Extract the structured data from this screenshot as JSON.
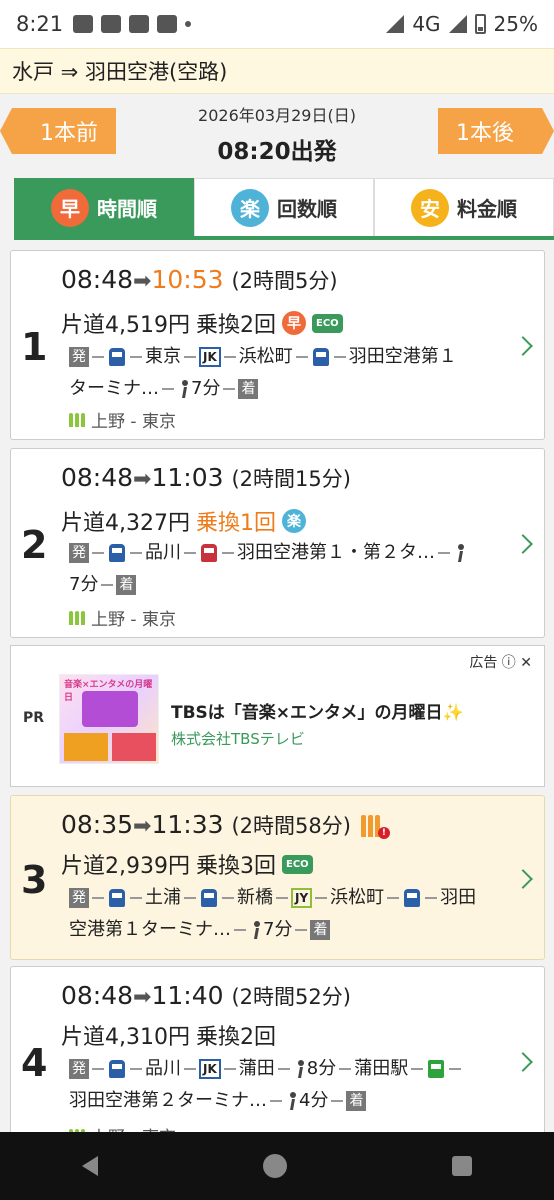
{
  "status": {
    "time": "8:21",
    "network": "4G",
    "battery": "25%"
  },
  "route": {
    "title": "水戸 ⇒ 羽田空港(空路)"
  },
  "date_nav": {
    "prev": "1本前",
    "next": "1本後",
    "date": "2026年03月29日(日)",
    "departure": "08:20出発"
  },
  "tabs": [
    {
      "badge": "早",
      "label": "時間順",
      "active": true
    },
    {
      "badge": "楽",
      "label": "回数順",
      "active": false
    },
    {
      "badge": "安",
      "label": "料金順",
      "active": false
    }
  ],
  "routes": [
    {
      "num": "1",
      "dep": "08:48",
      "arr": "10:53",
      "duration": "(2時間5分)",
      "fare": "片道4,519円",
      "transfers": "乗換2回",
      "path": {
        "start": "発",
        "s1": "東京",
        "line1": "JK",
        "s2": "浜松町",
        "s3": "羽田空港第１",
        "s3b": "ターミナ…",
        "walk": "7分",
        "end": "着"
      },
      "crowd": "上野 - 東京"
    },
    {
      "num": "2",
      "dep": "08:48",
      "arr": "11:03",
      "duration": "(2時間15分)",
      "fare": "片道4,327円",
      "transfers": "乗換1回",
      "path": {
        "start": "発",
        "s1": "品川",
        "s2": "羽田空港第１・第２タ…",
        "walk": "7分",
        "end": "着"
      },
      "crowd": "上野 - 東京"
    },
    {
      "num": "3",
      "dep": "08:35",
      "arr": "11:33",
      "duration": "(2時間58分)",
      "fare": "片道2,939円",
      "transfers": "乗換3回",
      "path": {
        "start": "発",
        "s1": "土浦",
        "s2": "新橋",
        "line1": "JY",
        "s3": "浜松町",
        "s4": "羽田",
        "s4b": "空港第１ターミナ…",
        "walk": "7分",
        "end": "着"
      }
    },
    {
      "num": "4",
      "dep": "08:48",
      "arr": "11:40",
      "duration": "(2時間52分)",
      "fare": "片道4,310円",
      "transfers": "乗換2回",
      "path": {
        "start": "発",
        "s1": "品川",
        "line1": "JK",
        "s2": "蒲田",
        "walk1": "8分",
        "s3": "蒲田駅",
        "s4": "羽田空港第２ターミナ…",
        "walk2": "4分",
        "end": "着"
      },
      "crowd": "上野 - 東京"
    }
  ],
  "ad": {
    "pr": "PR",
    "label": "広告",
    "thumb_title": "音楽×エンタメの月曜日",
    "title": "TBSは「音楽×エンタメ」の月曜日✨",
    "advertiser": "株式会社TBSテレビ"
  },
  "badges": {
    "fast": "早",
    "easy": "楽",
    "eco": "ECO"
  }
}
